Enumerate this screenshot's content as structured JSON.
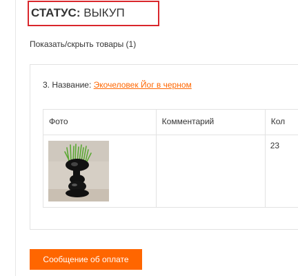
{
  "status": {
    "label": "СТАТУС:",
    "value": "ВЫКУП"
  },
  "toggle_products": "Показать/скрыть товары (1)",
  "product": {
    "name_prefix": "3. Название:",
    "name_link": "Экочеловек Йог в черном",
    "table": {
      "headers": [
        "Фото",
        "Комментарий",
        "Кол"
      ],
      "rows": [
        {
          "photo_icon": "plant-pot-photo",
          "comment": "",
          "quantity": "23"
        }
      ]
    }
  },
  "pay_button": "Сообщение об оплате",
  "colors": {
    "accent": "#ff6600",
    "status_border": "#d9262b",
    "border": "#e2e2e2"
  }
}
